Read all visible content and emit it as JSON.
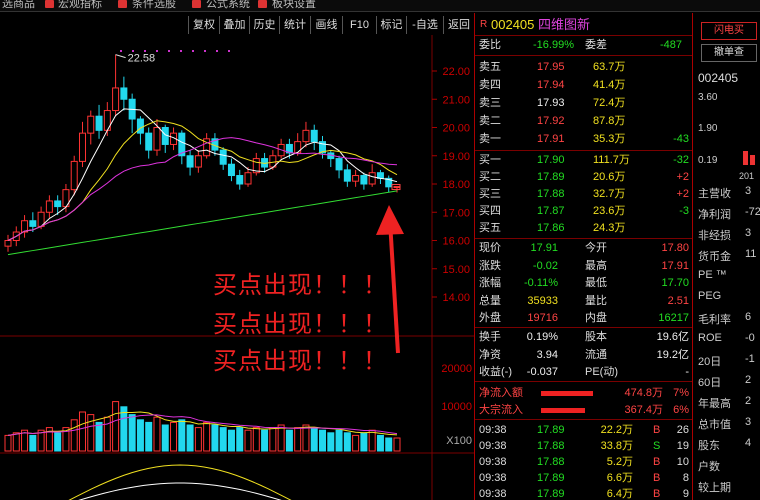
{
  "topmenu": {
    "items": [
      "选商品",
      "宏观指标",
      "条件选股",
      "公式系统",
      "板块设置"
    ]
  },
  "toolbar": {
    "buttons": [
      "复权",
      "叠加",
      "历史",
      "统计",
      "画线",
      "F10",
      "标记",
      "-自选",
      "返回"
    ]
  },
  "annotation": {
    "lines": [
      "买点出现！！！",
      "买点出现！！！",
      "买点出现！！！"
    ],
    "color": "#ee2222"
  },
  "chart_data": {
    "type": "candlestick",
    "price_axis": {
      "labels": [
        "22.00",
        "21.00",
        "20.00",
        "19.00",
        "18.00",
        "17.00",
        "16.00",
        "15.00",
        "14.00"
      ]
    },
    "volume_axis": {
      "labels": [
        "20000",
        "10000",
        "X100"
      ]
    },
    "high_label": "22.58",
    "candles": [
      {
        "o": 15.8,
        "c": 16.0,
        "h": 16.2,
        "l": 15.6
      },
      {
        "o": 16.0,
        "c": 16.3,
        "h": 16.5,
        "l": 15.8
      },
      {
        "o": 16.3,
        "c": 16.7,
        "h": 16.9,
        "l": 16.1
      },
      {
        "o": 16.7,
        "c": 16.5,
        "h": 17.0,
        "l": 16.3
      },
      {
        "o": 16.5,
        "c": 17.0,
        "h": 17.2,
        "l": 16.4
      },
      {
        "o": 17.0,
        "c": 17.4,
        "h": 17.6,
        "l": 16.8
      },
      {
        "o": 17.4,
        "c": 17.2,
        "h": 17.6,
        "l": 16.9
      },
      {
        "o": 17.2,
        "c": 17.8,
        "h": 18.0,
        "l": 17.0
      },
      {
        "o": 17.8,
        "c": 18.8,
        "h": 19.0,
        "l": 17.6
      },
      {
        "o": 18.8,
        "c": 19.8,
        "h": 20.2,
        "l": 18.6
      },
      {
        "o": 19.8,
        "c": 20.4,
        "h": 20.6,
        "l": 19.4
      },
      {
        "o": 20.4,
        "c": 19.9,
        "h": 20.8,
        "l": 19.6
      },
      {
        "o": 19.9,
        "c": 20.6,
        "h": 20.9,
        "l": 19.7
      },
      {
        "o": 20.6,
        "c": 21.4,
        "h": 22.58,
        "l": 20.4
      },
      {
        "o": 21.4,
        "c": 21.0,
        "h": 21.8,
        "l": 20.6
      },
      {
        "o": 21.0,
        "c": 20.3,
        "h": 21.2,
        "l": 19.8
      },
      {
        "o": 20.3,
        "c": 19.8,
        "h": 20.4,
        "l": 19.4
      },
      {
        "o": 19.8,
        "c": 19.2,
        "h": 20.0,
        "l": 18.9
      },
      {
        "o": 19.2,
        "c": 20.0,
        "h": 20.3,
        "l": 19.0
      },
      {
        "o": 20.0,
        "c": 19.4,
        "h": 20.1,
        "l": 19.1
      },
      {
        "o": 19.4,
        "c": 19.8,
        "h": 20.0,
        "l": 19.2
      },
      {
        "o": 19.8,
        "c": 19.0,
        "h": 19.9,
        "l": 18.7
      },
      {
        "o": 19.0,
        "c": 18.6,
        "h": 19.2,
        "l": 18.3
      },
      {
        "o": 18.6,
        "c": 19.0,
        "h": 19.2,
        "l": 18.4
      },
      {
        "o": 19.0,
        "c": 19.6,
        "h": 19.8,
        "l": 18.9
      },
      {
        "o": 19.6,
        "c": 19.2,
        "h": 19.8,
        "l": 19.0
      },
      {
        "o": 19.2,
        "c": 18.7,
        "h": 19.3,
        "l": 18.5
      },
      {
        "o": 18.7,
        "c": 18.3,
        "h": 18.9,
        "l": 18.1
      },
      {
        "o": 18.3,
        "c": 18.0,
        "h": 18.5,
        "l": 17.8
      },
      {
        "o": 18.0,
        "c": 18.4,
        "h": 18.6,
        "l": 17.9
      },
      {
        "o": 18.4,
        "c": 18.9,
        "h": 19.1,
        "l": 18.3
      },
      {
        "o": 18.9,
        "c": 18.6,
        "h": 19.1,
        "l": 18.4
      },
      {
        "o": 18.6,
        "c": 19.0,
        "h": 19.2,
        "l": 18.5
      },
      {
        "o": 19.0,
        "c": 19.4,
        "h": 19.6,
        "l": 18.9
      },
      {
        "o": 19.4,
        "c": 19.1,
        "h": 19.6,
        "l": 18.9
      },
      {
        "o": 19.1,
        "c": 19.5,
        "h": 19.8,
        "l": 19.0
      },
      {
        "o": 19.5,
        "c": 19.9,
        "h": 20.2,
        "l": 19.3
      },
      {
        "o": 19.9,
        "c": 19.5,
        "h": 20.1,
        "l": 19.2
      },
      {
        "o": 19.5,
        "c": 19.1,
        "h": 19.7,
        "l": 18.9
      },
      {
        "o": 19.1,
        "c": 18.9,
        "h": 19.2,
        "l": 18.6
      },
      {
        "o": 18.9,
        "c": 18.5,
        "h": 19.0,
        "l": 18.2
      },
      {
        "o": 18.5,
        "c": 18.1,
        "h": 18.7,
        "l": 17.9
      },
      {
        "o": 18.1,
        "c": 18.3,
        "h": 18.5,
        "l": 17.9
      },
      {
        "o": 18.3,
        "c": 18.0,
        "h": 18.4,
        "l": 17.8
      },
      {
        "o": 18.0,
        "c": 18.4,
        "h": 18.7,
        "l": 17.9
      },
      {
        "o": 18.4,
        "c": 18.2,
        "h": 18.5,
        "l": 18.0
      },
      {
        "o": 18.2,
        "c": 17.9,
        "h": 18.3,
        "l": 17.7
      },
      {
        "o": 17.9,
        "c": 17.91,
        "h": 17.91,
        "l": 17.7
      }
    ],
    "volumes": [
      6,
      7,
      8,
      6,
      8,
      9,
      7,
      9,
      12,
      15,
      14,
      11,
      13,
      19,
      17,
      14,
      12,
      11,
      13,
      10,
      11,
      12,
      10,
      9,
      11,
      10,
      9,
      8,
      9,
      8,
      9,
      8,
      9,
      10,
      8,
      9,
      10,
      9,
      8,
      7,
      8,
      7,
      6,
      7,
      8,
      6,
      5,
      5
    ]
  },
  "quote": {
    "code": "002405",
    "name": "四维图新",
    "weibi_label": "委比",
    "weibi_value": "-16.99%",
    "weicha_label": "委差",
    "weicha_value": "-487",
    "asks": [
      {
        "label": "卖五",
        "price": "17.95",
        "vol": "63.7万",
        "chg": ""
      },
      {
        "label": "卖四",
        "price": "17.94",
        "vol": "41.4万",
        "chg": ""
      },
      {
        "label": "卖三",
        "price": "17.93",
        "vol": "72.4万",
        "chg": ""
      },
      {
        "label": "卖二",
        "price": "17.92",
        "vol": "87.8万",
        "chg": ""
      },
      {
        "label": "卖一",
        "price": "17.91",
        "vol": "35.3万",
        "chg": "-43"
      }
    ],
    "bids": [
      {
        "label": "买一",
        "price": "17.90",
        "vol": "111.7万",
        "chg": "-32"
      },
      {
        "label": "买二",
        "price": "17.89",
        "vol": "20.6万",
        "chg": "+2"
      },
      {
        "label": "买三",
        "price": "17.88",
        "vol": "32.7万",
        "chg": "+2"
      },
      {
        "label": "买四",
        "price": "17.87",
        "vol": "23.6万",
        "chg": "-3"
      },
      {
        "label": "买五",
        "price": "17.86",
        "vol": "24.3万",
        "chg": ""
      }
    ],
    "stats": [
      {
        "l1": "现价",
        "v1": "17.91",
        "l2": "今开",
        "v2": "17.80"
      },
      {
        "l1": "涨跌",
        "v1": "-0.02",
        "l2": "最高",
        "v2": "17.91"
      },
      {
        "l1": "涨幅",
        "v1": "-0.11%",
        "l2": "最低",
        "v2": "17.70"
      },
      {
        "l1": "总量",
        "v1": "35933",
        "l2": "量比",
        "v2": "2.51"
      },
      {
        "l1": "外盘",
        "v1": "19716",
        "l2": "内盘",
        "v2": "16217"
      }
    ],
    "stats2": [
      {
        "l1": "换手",
        "v1": "0.19%",
        "l2": "股本",
        "v2": "19.6亿"
      },
      {
        "l1": "净资",
        "v1": "3.94",
        "l2": "流通",
        "v2": "19.2亿"
      },
      {
        "l1": "收益(-)",
        "v1": "-0.037",
        "l2": "PE(动)",
        "v2": "-"
      }
    ],
    "flows": [
      {
        "label": "净流入额",
        "value": "474.8万",
        "pct": "7%"
      },
      {
        "label": "大宗流入",
        "value": "367.4万",
        "pct": "6%"
      }
    ],
    "ticks": [
      {
        "time": "09:38",
        "price": "17.89",
        "vol": "22.2万",
        "side": "B",
        "n": "26"
      },
      {
        "time": "09:38",
        "price": "17.88",
        "vol": "33.8万",
        "side": "S",
        "n": "19"
      },
      {
        "time": "09:38",
        "price": "17.88",
        "vol": "5.2万",
        "side": "B",
        "n": "10"
      },
      {
        "time": "09:38",
        "price": "17.89",
        "vol": "6.6万",
        "side": "B",
        "n": "8"
      },
      {
        "time": "09:38",
        "price": "17.89",
        "vol": "6.4万",
        "side": "B",
        "n": "9"
      }
    ]
  },
  "side": {
    "btn1": "闪电买",
    "btn2": "撤单查",
    "code": "002405",
    "axis": [
      "3.60",
      "1.90",
      "0.19"
    ],
    "year": "201",
    "rows": [
      {
        "label": "主营收",
        "val": "3"
      },
      {
        "label": "净利润",
        "val": "-72"
      },
      {
        "label": "非经损",
        "val": "3"
      },
      {
        "label": "货币金",
        "val": "11"
      },
      {
        "label": "PE ™",
        "val": ""
      },
      {
        "label": "PEG",
        "val": ""
      },
      {
        "label": "毛利率",
        "val": "6"
      },
      {
        "label": "ROE",
        "val": "-0"
      },
      {
        "label": "20日",
        "val": "-1"
      },
      {
        "label": "60日",
        "val": "2"
      },
      {
        "label": "年最高",
        "val": "2"
      },
      {
        "label": "总市值",
        "val": "3"
      },
      {
        "label": "股东",
        "val": "4"
      },
      {
        "label": "户数",
        "val": ""
      },
      {
        "label": "较上期",
        "val": ""
      }
    ]
  },
  "colors": {
    "up": "#ff3333",
    "down": "#22d8ee",
    "ma5": "#ffffff",
    "ma10": "#f0e020",
    "ma20": "#dd33dd",
    "ma60": "#33dd33"
  }
}
